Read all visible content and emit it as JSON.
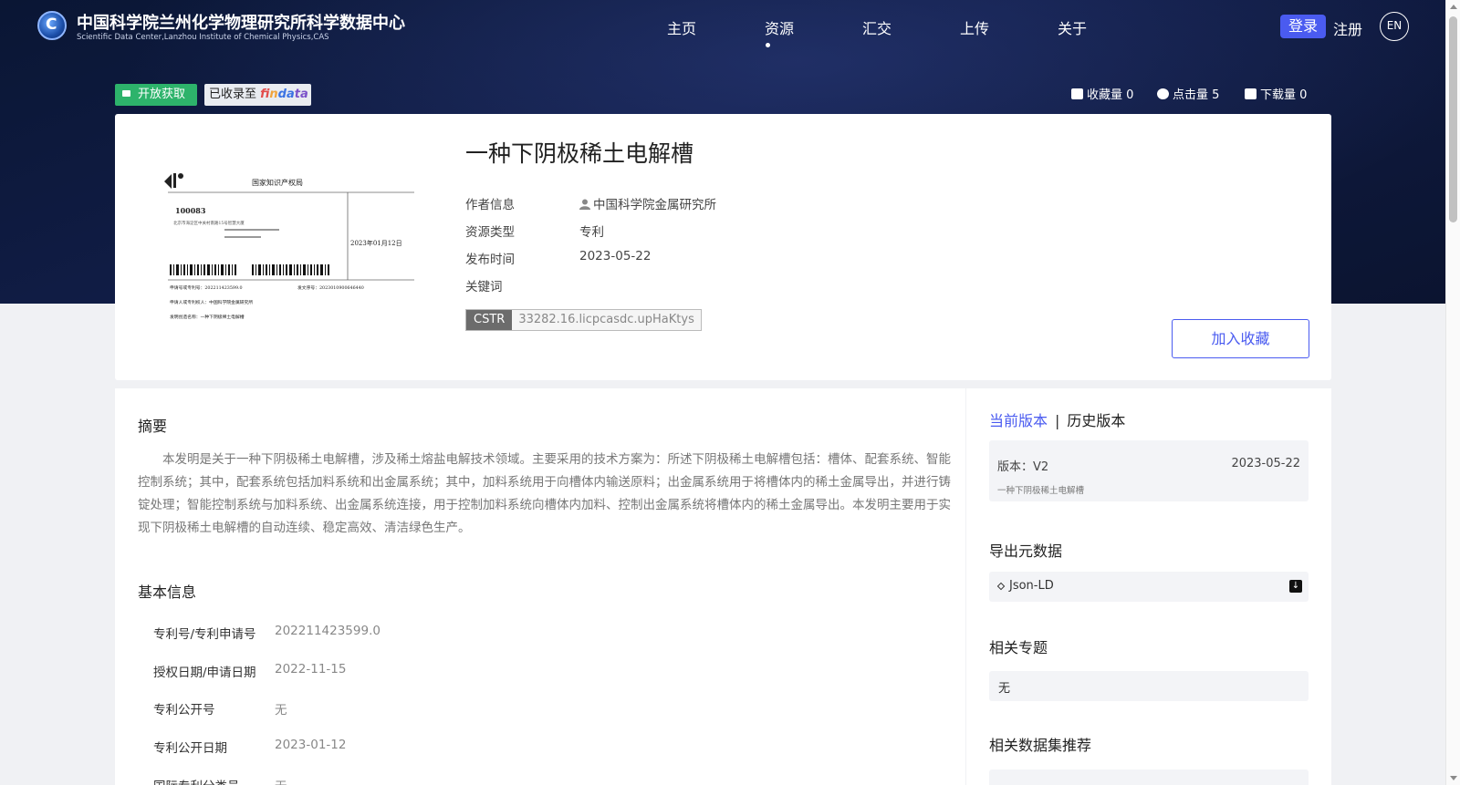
{
  "header": {
    "site_name_cn": "中国科学院兰州化学物理研究所科学数据中心",
    "site_name_en": "Scientific Data Center,Lanzhou Institute of Chemical Physics,CAS",
    "nav": [
      {
        "label": "主页"
      },
      {
        "label": "资源",
        "active": true
      },
      {
        "label": "汇交"
      },
      {
        "label": "上传"
      },
      {
        "label": "关于"
      }
    ],
    "login_label": "登录",
    "register_label": "注册",
    "lang_label": "EN"
  },
  "badges": {
    "open_access": "开放获取",
    "included_prefix": "已收录至",
    "findata_logo": "findata"
  },
  "stats": {
    "favorites_label": "收藏量",
    "favorites": "0",
    "clicks_label": "点击量",
    "clicks": "5",
    "downloads_label": "下载量",
    "downloads": "0"
  },
  "resource": {
    "title": "一种下阴极稀土电解槽",
    "author_label": "作者信息",
    "author": "中国科学院金属研究所",
    "type_label": "资源类型",
    "type": "专利",
    "date_label": "发布时间",
    "date": "2023-05-22",
    "keywords_label": "关键词",
    "cstr_key": "CSTR",
    "cstr_value": "33282.16.licpcasdc.upHaKtys",
    "favorite_button": "加入收藏"
  },
  "thumbnail": {
    "office": "国家知识产权局",
    "postcode": "100083",
    "address": "北京市海淀区中关村南路15号智慧大厦",
    "date_stamp": "2023年01月12日",
    "app_no": "申请号或专利号：202211423599.0",
    "doc_no": "发文序号：2023010900646440",
    "applicant": "申请人或专利权人：中国科学院金属研究所",
    "invention": "发明创造名称：一种下阴极稀土电解槽"
  },
  "abstract": {
    "heading": "摘要",
    "text": "本发明是关于一种下阴极稀土电解槽，涉及稀土熔盐电解技术领域。主要采用的技术方案为：所述下阴极稀土电解槽包括：槽体、配套系统、智能控制系统；其中，配套系统包括加料系统和出金属系统；其中，加料系统用于向槽体内输送原料；出金属系统用于将槽体内的稀土金属导出，并进行铸锭处理；智能控制系统与加料系统、出金属系统连接，用于控制加料系统向槽体内加料、控制出金属系统将槽体内的稀土金属导出。本发明主要用于实现下阴极稀土电解槽的自动连续、稳定高效、清洁绿色生产。"
  },
  "basic_info": {
    "heading": "基本信息",
    "rows": [
      {
        "label": "专利号/专利申请号",
        "value": "202211423599.0"
      },
      {
        "label": "授权日期/申请日期",
        "value": "2022-11-15"
      },
      {
        "label": "专利公开号",
        "value": "无"
      },
      {
        "label": "专利公开日期",
        "value": "2023-01-12"
      },
      {
        "label": "国际专利分类号",
        "value": "无"
      }
    ]
  },
  "version": {
    "current_tab": "当前版本",
    "history_tab": "历史版本",
    "version_label": "版本：V2",
    "version_date": "2023-05-22",
    "version_desc": "一种下阴极稀土电解槽"
  },
  "export": {
    "heading": "导出元数据",
    "format": "Json-LD"
  },
  "topics": {
    "heading": "相关专题",
    "value": "无"
  },
  "recommend": {
    "heading": "相关数据集推荐"
  },
  "colors": {
    "accent": "#4a5bf0",
    "open_green": "#2db36b",
    "hero_bg": "#0f1a3d"
  }
}
